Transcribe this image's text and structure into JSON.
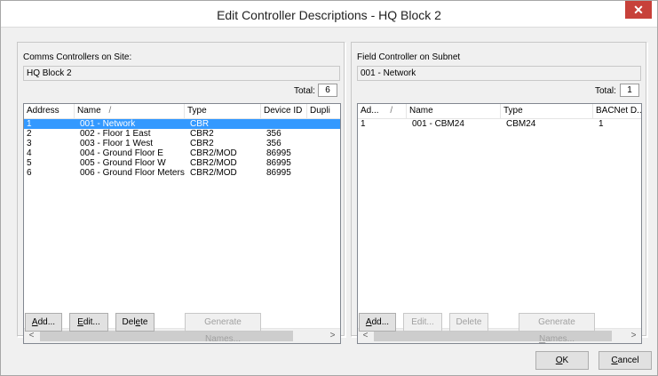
{
  "window": {
    "title": "Edit Controller Descriptions - HQ Block 2",
    "close_glyph": "✕"
  },
  "left": {
    "label": "Comms Controllers on Site:",
    "site_value": "HQ Block 2",
    "total_label": "Total:",
    "total_value": "6",
    "columns": [
      "Address",
      "Name",
      "Type",
      "Device ID",
      "Dupli"
    ],
    "rows": [
      [
        "1",
        "001 - Network",
        "CBR",
        ""
      ],
      [
        "2",
        "002 - Floor 1 East",
        "CBR2",
        "356"
      ],
      [
        "3",
        "003 - Floor 1 West",
        "CBR2",
        "356"
      ],
      [
        "4",
        "004 - Ground Floor E",
        "CBR2/MOD",
        "86995"
      ],
      [
        "5",
        "005 - Ground Floor W",
        "CBR2/MOD",
        "86995"
      ],
      [
        "6",
        "006 - Ground Floor Meters",
        "CBR2/MOD",
        "86995"
      ]
    ],
    "selected_row": 0,
    "buttons": {
      "add_pre": "A",
      "add_post": "dd...",
      "edit_pre": "E",
      "edit_post": "dit...",
      "delete_pre": "Del",
      "delete_u": "e",
      "delete_post": "te",
      "generate": "Generate Names..."
    }
  },
  "right": {
    "label": "Field Controller on Subnet",
    "subnet_value": "001 - Network",
    "total_label": "Total:",
    "total_value": "1",
    "columns": [
      "Ad...",
      "Name",
      "Type",
      "BACNet D..."
    ],
    "rows": [
      [
        "1",
        "001 - CBM24",
        "CBM24",
        "1"
      ]
    ],
    "buttons": {
      "add_pre": "A",
      "add_post": "dd...",
      "edit": "Edit...",
      "delete": "Delete",
      "generate_pre": "Generate ",
      "generate_u": "N",
      "generate_post": "ames..."
    }
  },
  "footer": {
    "ok_u": "O",
    "ok_post": "K",
    "cancel_u": "C",
    "cancel_post": "ancel"
  },
  "colors": {
    "selection": "#3399ff",
    "close": "#c7413a"
  },
  "icons": {
    "scroll_left": "<",
    "scroll_right": ">",
    "sort": "/"
  }
}
